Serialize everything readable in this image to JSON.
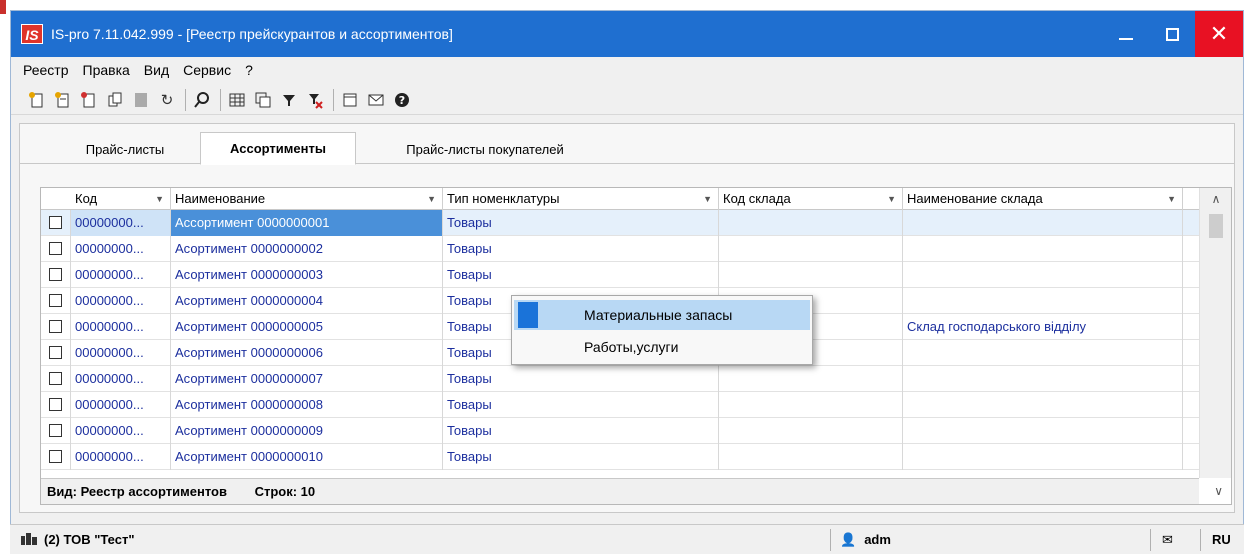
{
  "window": {
    "title": "IS-pro 7.11.042.999 - [Реестр прейскурантов и ассортиментов]",
    "logo": "IS"
  },
  "menu": [
    "Реестр",
    "Правка",
    "Вид",
    "Сервис",
    "?"
  ],
  "toolbar_icons": [
    "new-doc-icon",
    "new-doc-2-icon",
    "new-doc-3-icon",
    "copy-icon",
    "gray-block-icon",
    "refresh-icon",
    "search-icon",
    "table-icon",
    "tree-icon",
    "filter-icon",
    "clear-filter-icon",
    "form-icon",
    "mail-icon",
    "help-icon"
  ],
  "tabs": [
    "Прайс-листы",
    "Ассортименты",
    "Прайс-листы покупателей"
  ],
  "active_tab": "Ассортименты",
  "grid": {
    "columns": [
      "Код",
      "Наименование",
      "Тип номенклатуры",
      "Код склада",
      "Наименование склада"
    ],
    "rows": [
      {
        "code": "00000000...",
        "name": "Ассортимент 0000000001",
        "type": "Товары",
        "store_code": "",
        "store_name": ""
      },
      {
        "code": "00000000...",
        "name": "Асортимент 0000000002",
        "type": "Товары",
        "store_code": "",
        "store_name": ""
      },
      {
        "code": "00000000...",
        "name": "Асортимент 0000000003",
        "type": "Товары",
        "store_code": "",
        "store_name": ""
      },
      {
        "code": "00000000...",
        "name": "Асортимент 0000000004",
        "type": "Товары",
        "store_code": "",
        "store_name": ""
      },
      {
        "code": "00000000...",
        "name": "Асортимент 0000000005",
        "type": "Товары",
        "store_code": "",
        "store_name": "Склад господарського відділу"
      },
      {
        "code": "00000000...",
        "name": "Асортимент 0000000006",
        "type": "Товары",
        "store_code": "",
        "store_name": ""
      },
      {
        "code": "00000000...",
        "name": "Асортимент 0000000007",
        "type": "Товары",
        "store_code": "",
        "store_name": ""
      },
      {
        "code": "00000000...",
        "name": "Асортимент 0000000008",
        "type": "Товары",
        "store_code": "",
        "store_name": ""
      },
      {
        "code": "00000000...",
        "name": "Асортимент 0000000009",
        "type": "Товары",
        "store_code": "",
        "store_name": ""
      },
      {
        "code": "00000000...",
        "name": "Асортимент 0000000010",
        "type": "Товары",
        "store_code": "",
        "store_name": ""
      }
    ],
    "footer": {
      "view_label": "Вид: Реестр ассортиментов",
      "rows_label": "Строк: 10"
    }
  },
  "context_menu": [
    "Материальные запасы",
    "Работы,услуги"
  ],
  "status": {
    "company": "(2) ТОВ \"Тест\"",
    "user": "adm",
    "lang": "RU"
  },
  "colors": {
    "titlebar": "#1f6fd0",
    "close": "#e81123",
    "selection": "#4a90d9",
    "link_text": "#1c2f9e"
  }
}
